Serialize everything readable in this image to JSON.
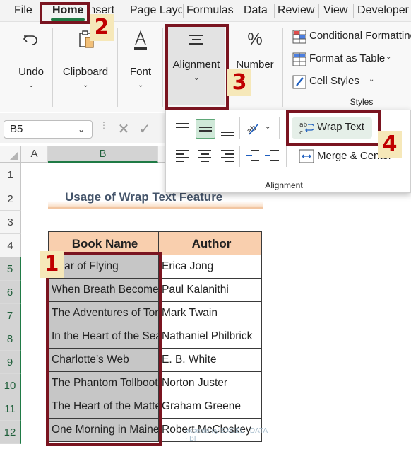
{
  "menu": {
    "tabs": [
      "File",
      "Home",
      "Insert",
      "Page Layout",
      "Formulas",
      "Data",
      "Review",
      "View",
      "Developer"
    ]
  },
  "ribbon": {
    "undo_label": "Undo",
    "clipboard_label": "Clipboard",
    "font_label": "Font",
    "alignment_label": "Alignment",
    "number_label": "Number",
    "conditional_formatting": "Conditional Formatting",
    "format_as_table": "Format as Table",
    "cell_styles": "Cell Styles",
    "styles_group": "Styles"
  },
  "alignment_panel": {
    "wrap_text": "Wrap Text",
    "merge_center": "Merge & Center",
    "group_label": "Alignment"
  },
  "formula_bar": {
    "name_box": "B5"
  },
  "grid": {
    "columns": [
      "A",
      "B"
    ],
    "rows": [
      "1",
      "2",
      "3",
      "4",
      "5",
      "6",
      "7",
      "8",
      "9",
      "10",
      "11",
      "12"
    ],
    "title": "Usage of Wrap Text Feature",
    "headers": [
      "Book Name",
      "Author"
    ],
    "data": [
      [
        "Fear of Flying",
        "Erica Jong"
      ],
      [
        "When Breath Becomes Air",
        "Paul Kalanithi"
      ],
      [
        "The Adventures of Tom Sawyer",
        "Mark Twain"
      ],
      [
        "In the Heart of the Sea",
        "Nathaniel Philbrick"
      ],
      [
        "Charlotte’s Web",
        "E. B. White"
      ],
      [
        "The Phantom Tollbooth",
        "Norton Juster"
      ],
      [
        "The Heart of the Matter",
        "Graham Greene"
      ],
      [
        "One Morning in Maine",
        "Robert McCloskey"
      ]
    ]
  },
  "callouts": [
    "1",
    "2",
    "3",
    "4"
  ],
  "watermark": "exceldemy EXCEL · DATA · BI",
  "colors": {
    "header_fill": "#f9cfae",
    "title_text": "#44546a",
    "selection_fill": "#c6c6c6",
    "callout_border": "#7a1420",
    "callout_fill": "#f6e8b9",
    "callout_text": "#c00000",
    "excel_green": "#1f7a45"
  }
}
